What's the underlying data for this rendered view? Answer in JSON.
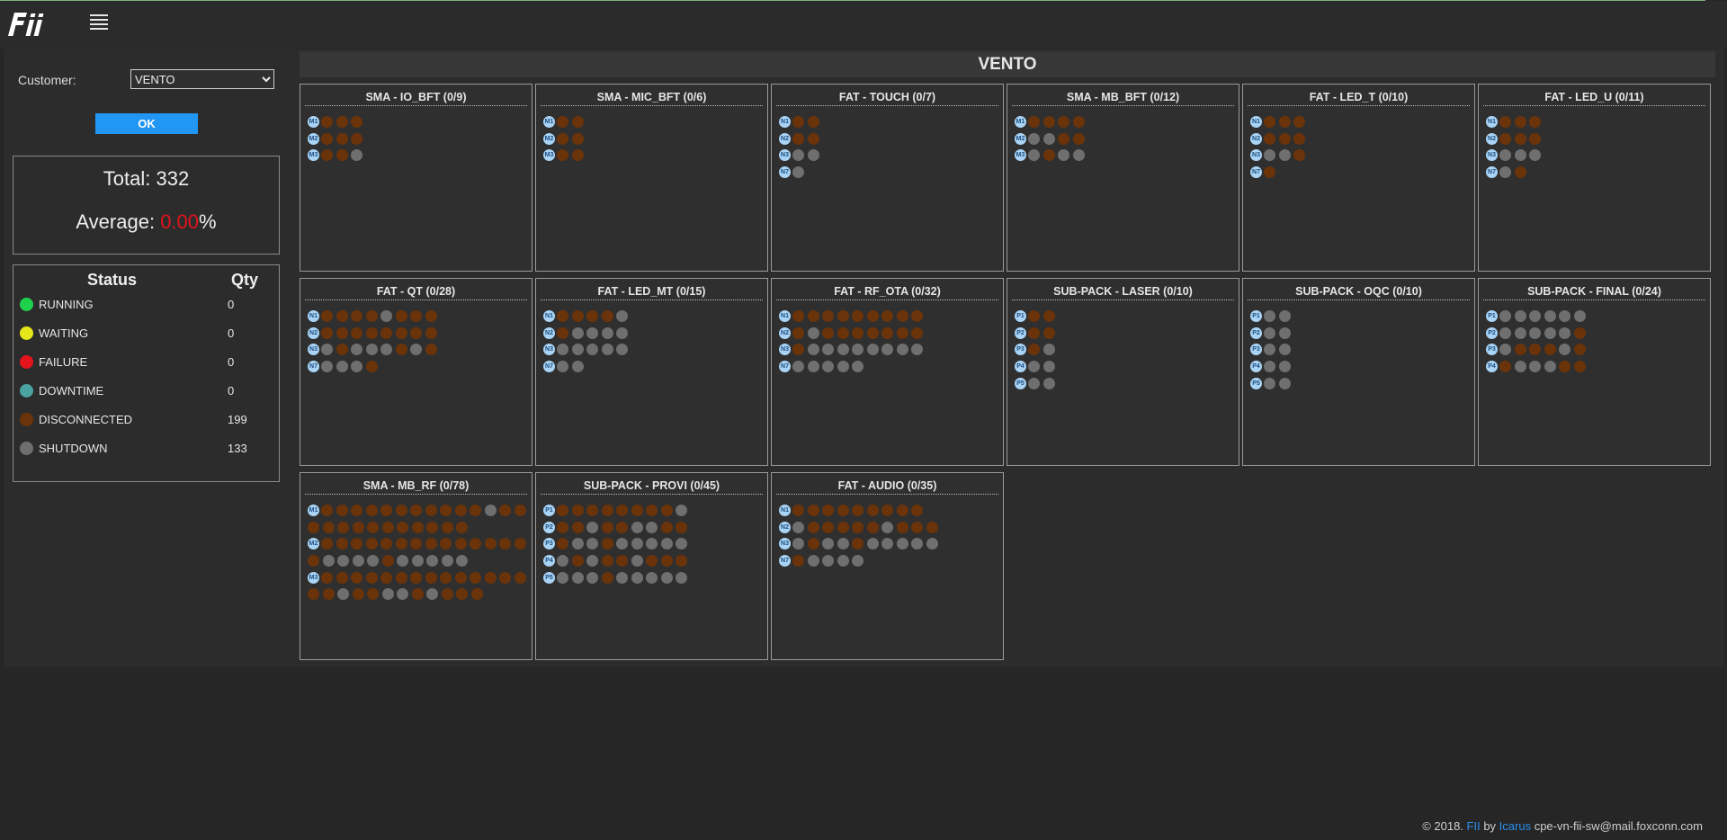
{
  "header": {
    "logo_icon": "fii-logo-icon",
    "menu_icon": "hamburger-menu-icon"
  },
  "sidebar": {
    "customer_label": "Customer:",
    "customer_selected": "VENTO",
    "customer_options": [
      "VENTO"
    ],
    "ok_label": "OK",
    "total": "Total: 332",
    "average_label": "Average: ",
    "average_value": "0.00",
    "average_suffix": "%",
    "status_header": "Status",
    "qty_header": "Qty",
    "statuses": [
      {
        "label": "RUNNING",
        "qty": "0",
        "color": "#1fd14a"
      },
      {
        "label": "WAITING",
        "qty": "0",
        "color": "#e6e61b"
      },
      {
        "label": "FAILURE",
        "qty": "0",
        "color": "#e3141c"
      },
      {
        "label": "DOWNTIME",
        "qty": "0",
        "color": "#4aa3a0"
      },
      {
        "label": "DISCONNECTED",
        "qty": "199",
        "color": "#6b3309"
      },
      {
        "label": "SHUTDOWN",
        "qty": "133",
        "color": "#6f6f6f"
      }
    ]
  },
  "dashboard_title": "VENTO",
  "panels": [
    {
      "title": "SMA - IO_BFT (0/9)",
      "rows": [
        {
          "line": "M1",
          "states": "DDD"
        },
        {
          "line": "M2",
          "states": "DDD"
        },
        {
          "line": "M3",
          "states": "DDS"
        }
      ]
    },
    {
      "title": "SMA - MIC_BFT (0/6)",
      "rows": [
        {
          "line": "M1",
          "states": "DD"
        },
        {
          "line": "M2",
          "states": "DD"
        },
        {
          "line": "M3",
          "states": "DD"
        }
      ]
    },
    {
      "title": "FAT - TOUCH (0/7)",
      "rows": [
        {
          "line": "N1",
          "states": "DD"
        },
        {
          "line": "N2",
          "states": "DD"
        },
        {
          "line": "N3",
          "states": "SS"
        },
        {
          "line": "N7",
          "states": "S"
        }
      ]
    },
    {
      "title": "SMA - MB_BFT (0/12)",
      "rows": [
        {
          "line": "M1",
          "states": "DDDD"
        },
        {
          "line": "M2",
          "states": "SSDD"
        },
        {
          "line": "M3",
          "states": "SDSS"
        }
      ]
    },
    {
      "title": "FAT - LED_T (0/10)",
      "rows": [
        {
          "line": "N1",
          "states": "DDD"
        },
        {
          "line": "N2",
          "states": "DDD"
        },
        {
          "line": "N3",
          "states": "SSD"
        },
        {
          "line": "N7",
          "states": "D"
        }
      ]
    },
    {
      "title": "FAT - LED_U (0/11)",
      "rows": [
        {
          "line": "N1",
          "states": "DDD"
        },
        {
          "line": "N2",
          "states": "DDD"
        },
        {
          "line": "N3",
          "states": "SSS"
        },
        {
          "line": "N7",
          "states": "SD"
        }
      ]
    },
    {
      "title": "FAT - QT (0/28)",
      "rows": [
        {
          "line": "N1",
          "states": "DDDDSDDD"
        },
        {
          "line": "N2",
          "states": "DDDDDDDD"
        },
        {
          "line": "N3",
          "states": "SDSSSDSD"
        },
        {
          "line": "N7",
          "states": "SSSD"
        }
      ]
    },
    {
      "title": "FAT - LED_MT (0/15)",
      "rows": [
        {
          "line": "N1",
          "states": "DDDDS"
        },
        {
          "line": "N2",
          "states": "DSSSS"
        },
        {
          "line": "N3",
          "states": "SSSSS"
        },
        {
          "line": "N7",
          "states": "SS"
        }
      ]
    },
    {
      "title": "FAT - RF_OTA (0/32)",
      "rows": [
        {
          "line": "N1",
          "states": "DDDDDDDDD"
        },
        {
          "line": "N2",
          "states": "DSDDDDDDD"
        },
        {
          "line": "N3",
          "states": "DSSSSSSSS"
        },
        {
          "line": "N7",
          "states": "SSSSS"
        }
      ]
    },
    {
      "title": "SUB-PACK - LASER (0/10)",
      "rows": [
        {
          "line": "P1",
          "states": "DD"
        },
        {
          "line": "P2",
          "states": "DD"
        },
        {
          "line": "P3",
          "states": "DS"
        },
        {
          "line": "P4",
          "states": "SS"
        },
        {
          "line": "P5",
          "states": "SS"
        }
      ]
    },
    {
      "title": "SUB-PACK - OQC (0/10)",
      "rows": [
        {
          "line": "P1",
          "states": "SS"
        },
        {
          "line": "P2",
          "states": "SS"
        },
        {
          "line": "P3",
          "states": "SS"
        },
        {
          "line": "P4",
          "states": "SS"
        },
        {
          "line": "P5",
          "states": "SS"
        }
      ]
    },
    {
      "title": "SUB-PACK - FINAL (0/24)",
      "rows": [
        {
          "line": "P1",
          "states": "SSSSSS"
        },
        {
          "line": "P2",
          "states": "SSSSSD"
        },
        {
          "line": "P3",
          "states": "SDDDSD"
        },
        {
          "line": "P4",
          "states": "DSSSDD"
        }
      ]
    },
    {
      "title": "SMA - MB_RF (0/78)",
      "rows": [
        {
          "line": "M1",
          "states": "DDDDDDDDDDDSDD"
        },
        {
          "line": "",
          "states": "DDDDDDDDDDD"
        },
        {
          "line": "M2",
          "states": "DDDDDDDDDDDDDD"
        },
        {
          "line": "",
          "states": "DSSSSDSSSSS"
        },
        {
          "line": "M3",
          "states": "DDDDDDDDDDDDDD"
        },
        {
          "line": "",
          "states": "DDSDDSSDSDDD"
        }
      ]
    },
    {
      "title": "SUB-PACK - PROVI (0/45)",
      "rows": [
        {
          "line": "P1",
          "states": "DDDDDDDDS"
        },
        {
          "line": "P2",
          "states": "DDSDDSSDD"
        },
        {
          "line": "P3",
          "states": "DSSDSSSSS"
        },
        {
          "line": "P4",
          "states": "SDSDDSDDD"
        },
        {
          "line": "P5",
          "states": "SSSDSSSSS"
        }
      ]
    },
    {
      "title": "FAT - AUDIO (0/35)",
      "rows": [
        {
          "line": "N1",
          "states": "DDDDDDDDD"
        },
        {
          "line": "N2",
          "states": "SDDDDDSDDD"
        },
        {
          "line": "N3",
          "states": "SDSSDSSSSS"
        },
        {
          "line": "N7",
          "states": "DSSSS"
        }
      ]
    }
  ],
  "footer": {
    "copyright": "© 2018. ",
    "company": "FII",
    "by": " by ",
    "author": "Icarus",
    "email": " cpe-vn-fii-sw@mail.foxconn.com"
  }
}
